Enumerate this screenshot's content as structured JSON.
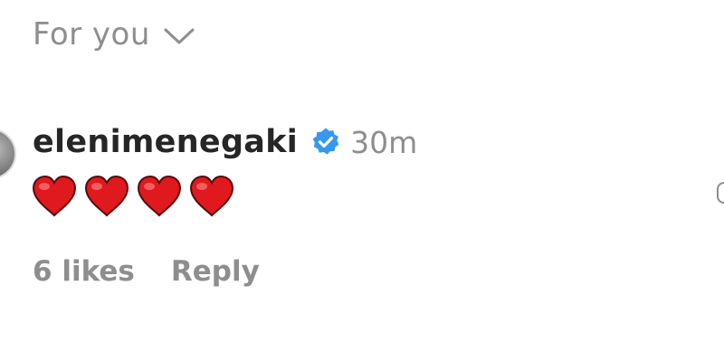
{
  "sort_menu": {
    "label": "For you",
    "icon": "chevron-down-icon"
  },
  "comment": {
    "username": "elenimenegaki",
    "verified_icon": "verified-badge-icon",
    "verified_color": "#3897f0",
    "timestamp": "30m",
    "body_icons": [
      "red-heart-emoji",
      "red-heart-emoji",
      "red-heart-emoji",
      "red-heart-emoji"
    ],
    "heart_color": "#e0191e",
    "likes": "6 likes",
    "reply_label": "Reply"
  }
}
